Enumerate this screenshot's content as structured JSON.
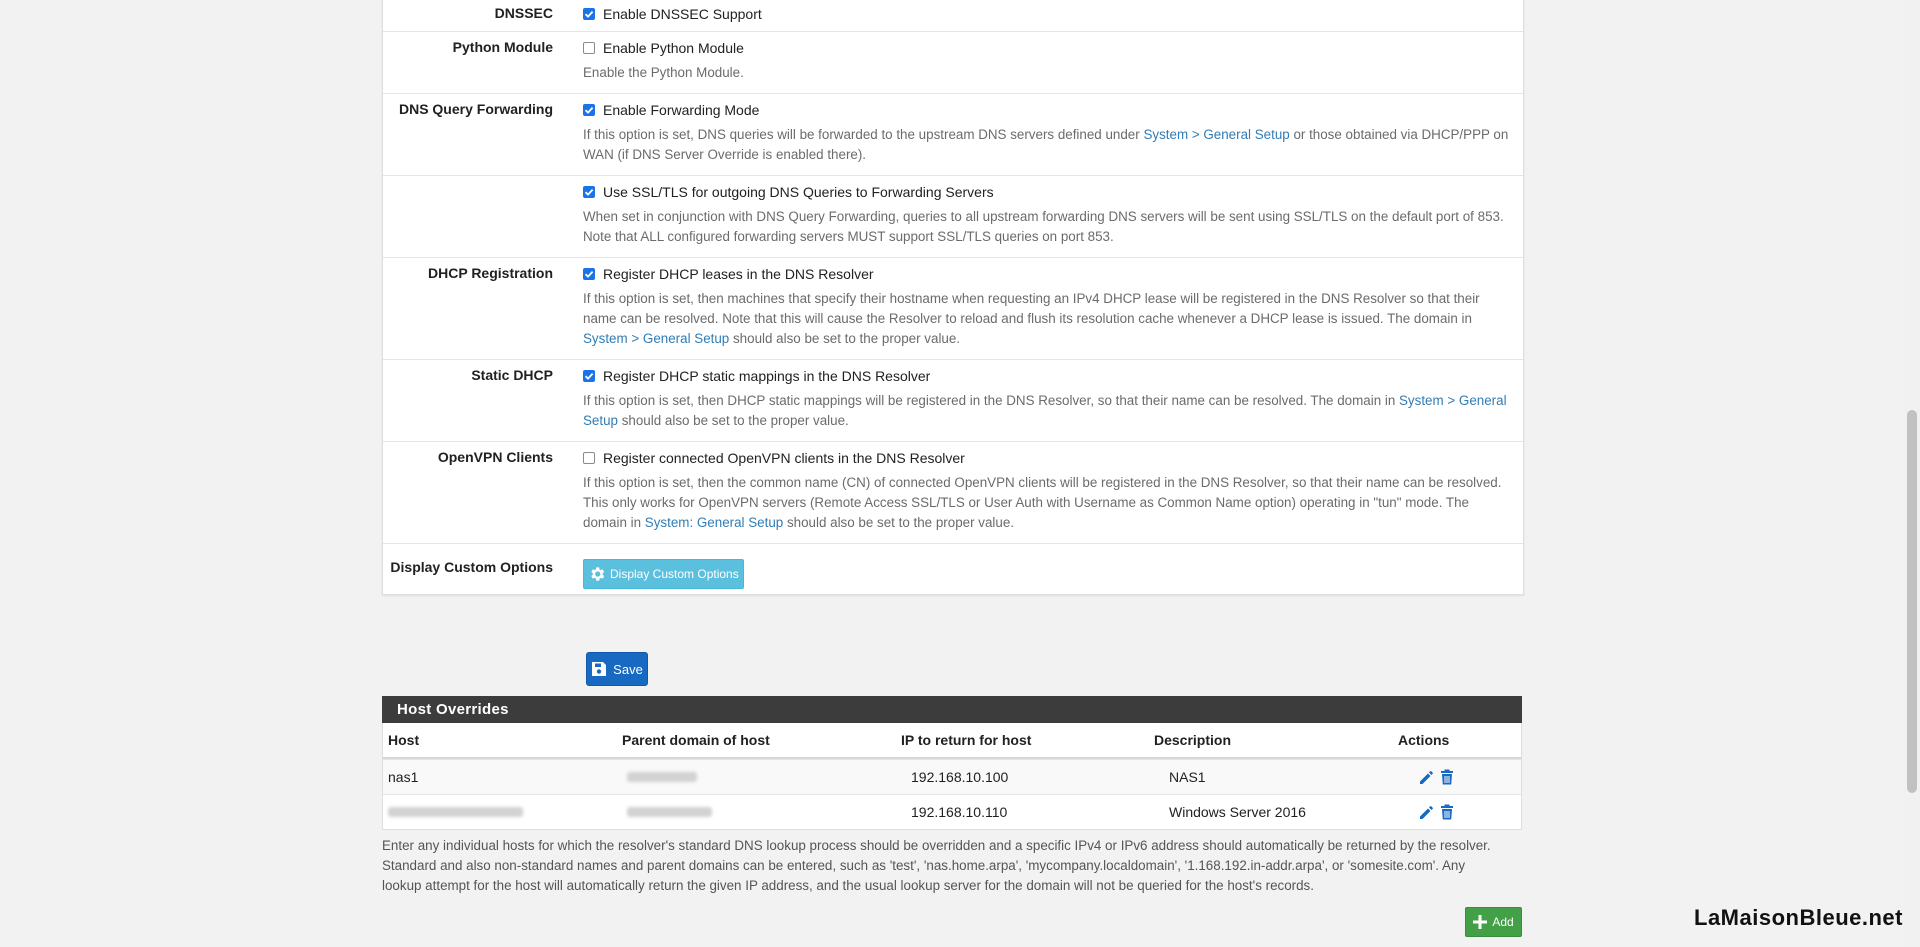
{
  "settings": {
    "dnssec": {
      "label": "DNSSEC",
      "checkbox": "Enable DNSSEC Support",
      "checked": true
    },
    "python": {
      "label": "Python Module",
      "checkbox": "Enable Python Module",
      "checked": false,
      "help": "Enable the Python Module."
    },
    "forwarding": {
      "label": "DNS Query Forwarding",
      "checkbox": "Enable Forwarding Mode",
      "checked": true,
      "help_a": "If this option is set, DNS queries will be forwarded to the upstream DNS servers defined under ",
      "help_link": "System > General Setup",
      "help_b": " or those obtained via DHCP/PPP on WAN (if DNS Server Override is enabled there)."
    },
    "ssl": {
      "label": "",
      "checkbox": "Use SSL/TLS for outgoing DNS Queries to Forwarding Servers",
      "checked": true,
      "help": "When set in conjunction with DNS Query Forwarding, queries to all upstream forwarding DNS servers will be sent using SSL/TLS on the default port of 853. Note that ALL configured forwarding servers MUST support SSL/TLS queries on port 853."
    },
    "dhcp_reg": {
      "label": "DHCP Registration",
      "checkbox": "Register DHCP leases in the DNS Resolver",
      "checked": true,
      "help_a": "If this option is set, then machines that specify their hostname when requesting an IPv4 DHCP lease will be registered in the DNS Resolver so that their name can be resolved. Note that this will cause the Resolver to reload and flush its resolution cache whenever a DHCP lease is issued. The domain in ",
      "help_link": "System > General Setup",
      "help_b": " should also be set to the proper value."
    },
    "static_dhcp": {
      "label": "Static DHCP",
      "checkbox": "Register DHCP static mappings in the DNS Resolver",
      "checked": true,
      "help_a": "If this option is set, then DHCP static mappings will be registered in the DNS Resolver, so that their name can be resolved. The domain in ",
      "help_link": "System > General Setup",
      "help_b": " should also be set to the proper value."
    },
    "openvpn": {
      "label": "OpenVPN Clients",
      "checkbox": "Register connected OpenVPN clients in the DNS Resolver",
      "checked": false,
      "help_a": "If this option is set, then the common name (CN) of connected OpenVPN clients will be registered in the DNS Resolver, so that their name can be resolved. This only works for OpenVPN servers (Remote Access SSL/TLS or User Auth with Username as Common Name option) operating in \"tun\" mode. The domain in ",
      "help_link": "System: General Setup",
      "help_b": " should also be set to the proper value."
    },
    "custom": {
      "label": "Display Custom Options",
      "button": "Display Custom Options"
    }
  },
  "save_label": "Save",
  "host_overrides": {
    "title": "Host Overrides",
    "columns": [
      "Host",
      "Parent domain of host",
      "IP to return for host",
      "Description",
      "Actions"
    ],
    "rows": [
      {
        "host": "nas1",
        "ip": "192.168.10.100",
        "description": "NAS1"
      },
      {
        "host": "",
        "ip": "192.168.10.110",
        "description": "Windows Server 2016"
      }
    ],
    "note": "Enter any individual hosts for which the resolver's standard DNS lookup process should be overridden and a specific IPv4 or IPv6 address should automatically be returned by the resolver. Standard and also non-standard names and parent domains can be entered, such as 'test', 'nas.home.arpa', 'mycompany.localdomain', '1.168.192.in-addr.arpa', or 'somesite.com'. Any lookup attempt for the host will automatically return the given IP address, and the usual lookup server for the domain will not be queried for the host's records.",
    "add_label": "Add"
  },
  "watermark": "LaMaisonBleue.net",
  "colors": {
    "accent": "#1769c2",
    "info": "#5bc0de",
    "success": "#43a047",
    "link": "#317cb5"
  }
}
